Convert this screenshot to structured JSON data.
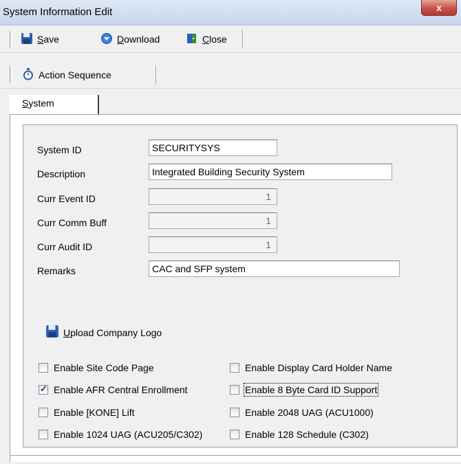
{
  "window": {
    "title": "System Information Edit",
    "close_glyph": "x"
  },
  "toolbar": {
    "save_label": "Save",
    "download_label": "Download",
    "close_label": "Close",
    "action_sequence_label": "Action Sequence"
  },
  "tabs": [
    {
      "label": "System",
      "active": true
    }
  ],
  "form": {
    "system_id": {
      "label": "System ID",
      "value": "SECURITYSYS"
    },
    "description": {
      "label": "Description",
      "value": "Integrated Building Security System"
    },
    "curr_event_id": {
      "label": "Curr Event ID",
      "value": "1"
    },
    "curr_comm_buff": {
      "label": "Curr Comm Buff",
      "value": "1"
    },
    "curr_audit_id": {
      "label": "Curr Audit ID",
      "value": "1"
    },
    "remarks": {
      "label": "Remarks",
      "value": "CAC and SFP system"
    }
  },
  "upload_logo_label": "Upload Company Logo",
  "options": [
    {
      "label": "Enable Site Code Page",
      "checked": false
    },
    {
      "label": "Enable Display Card Holder Name",
      "checked": false
    },
    {
      "label": "Enable AFR Central Enrollment",
      "checked": true
    },
    {
      "label": "Enable 8 Byte Card ID Support",
      "checked": false,
      "focused": true
    },
    {
      "label": "Enable [KONE] Lift",
      "checked": false
    },
    {
      "label": "Enable 2048 UAG (ACU1000)",
      "checked": false
    },
    {
      "label": "Enable 1024 UAG (ACU205/C302)",
      "checked": false
    },
    {
      "label": "Enable 128 Schedule (C302)",
      "checked": false
    }
  ],
  "icons": {
    "save": "floppy-disk-icon",
    "download": "download-arrow-icon",
    "close": "door-exit-icon",
    "action_sequence": "stopwatch-icon",
    "upload": "floppy-disk-icon"
  },
  "colors": {
    "accent_blue": "#1f5fbf",
    "close_red": "#c75050"
  }
}
